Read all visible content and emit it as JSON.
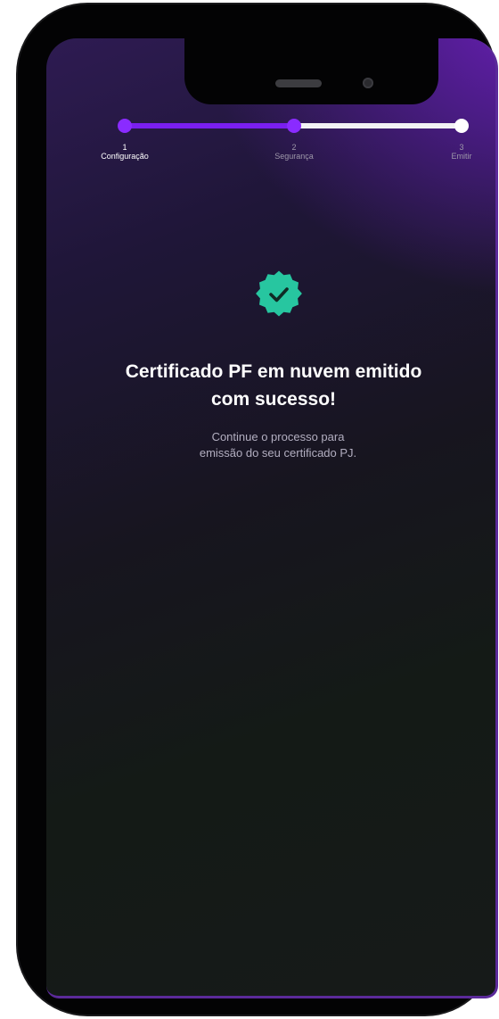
{
  "stepper": {
    "steps": [
      {
        "number": "1",
        "label": "Configuração",
        "state": "done"
      },
      {
        "number": "2",
        "label": "Segurança",
        "state": "current"
      },
      {
        "number": "3",
        "label": "Emitir",
        "state": "pending"
      }
    ],
    "progress": 0.5
  },
  "success": {
    "icon": "verified-check-badge-icon",
    "title_line1": "Certificado PF em nuvem emitido",
    "title_line2": "com sucesso!",
    "subtitle_line1": "Continue o processo para",
    "subtitle_line2": "emissão do seu certificado PJ."
  },
  "colors": {
    "accent": "#8a2bff",
    "success": "#27c6a0",
    "background": "#17151f"
  }
}
